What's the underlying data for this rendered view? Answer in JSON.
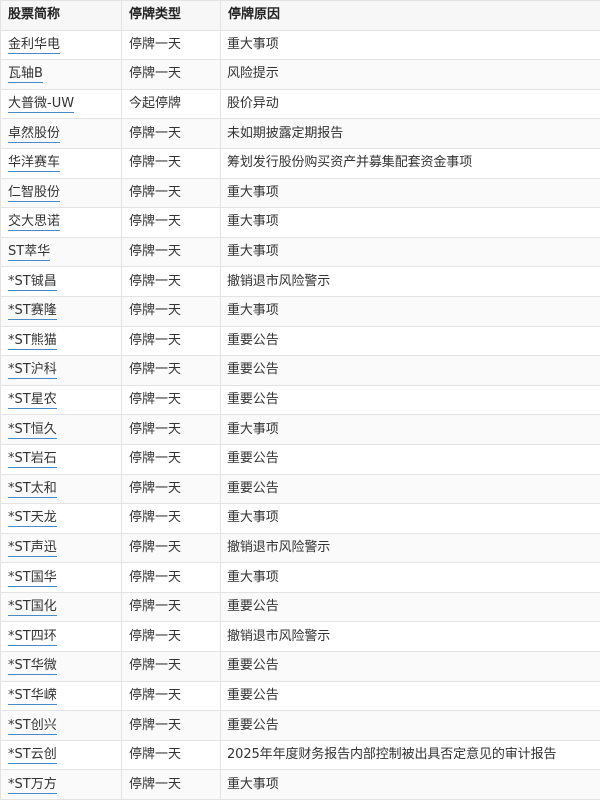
{
  "table": {
    "headers": [
      "股票简称",
      "停牌类型",
      "停牌原因"
    ],
    "rows": [
      {
        "name": "金利华电",
        "type": "停牌一天",
        "reason": "重大事项"
      },
      {
        "name": "瓦轴B",
        "type": "停牌一天",
        "reason": "风险提示"
      },
      {
        "name": "大普微-UW",
        "type": "今起停牌",
        "reason": "股价异动"
      },
      {
        "name": "卓然股份",
        "type": "停牌一天",
        "reason": "未如期披露定期报告"
      },
      {
        "name": "华洋赛车",
        "type": "停牌一天",
        "reason": "筹划发行股份购买资产并募集配套资金事项"
      },
      {
        "name": "仁智股份",
        "type": "停牌一天",
        "reason": "重大事项"
      },
      {
        "name": "交大思诺",
        "type": "停牌一天",
        "reason": "重大事项"
      },
      {
        "name": "ST萃华",
        "type": "停牌一天",
        "reason": "重大事项"
      },
      {
        "name": "*ST铖昌",
        "type": "停牌一天",
        "reason": "撤销退市风险警示"
      },
      {
        "name": "*ST赛隆",
        "type": "停牌一天",
        "reason": "重大事项"
      },
      {
        "name": "*ST熊猫",
        "type": "停牌一天",
        "reason": "重要公告"
      },
      {
        "name": "*ST沪科",
        "type": "停牌一天",
        "reason": "重要公告"
      },
      {
        "name": "*ST星农",
        "type": "停牌一天",
        "reason": "重要公告"
      },
      {
        "name": "*ST恒久",
        "type": "停牌一天",
        "reason": "重大事项"
      },
      {
        "name": "*ST岩石",
        "type": "停牌一天",
        "reason": "重要公告"
      },
      {
        "name": "*ST太和",
        "type": "停牌一天",
        "reason": "重要公告"
      },
      {
        "name": "*ST天龙",
        "type": "停牌一天",
        "reason": "重大事项"
      },
      {
        "name": "*ST声迅",
        "type": "停牌一天",
        "reason": "撤销退市风险警示"
      },
      {
        "name": "*ST国华",
        "type": "停牌一天",
        "reason": "重大事项"
      },
      {
        "name": "*ST国化",
        "type": "停牌一天",
        "reason": "重要公告"
      },
      {
        "name": "*ST四环",
        "type": "停牌一天",
        "reason": "撤销退市风险警示"
      },
      {
        "name": "*ST华微",
        "type": "停牌一天",
        "reason": "重要公告"
      },
      {
        "name": "*ST华嵘",
        "type": "停牌一天",
        "reason": "重要公告"
      },
      {
        "name": "*ST创兴",
        "type": "停牌一天",
        "reason": "重要公告"
      },
      {
        "name": "*ST云创",
        "type": "停牌一天",
        "reason": "2025年年度财务报告内部控制被出具否定意见的审计报告"
      },
      {
        "name": "*ST万方",
        "type": "停牌一天",
        "reason": "重大事项"
      }
    ]
  }
}
